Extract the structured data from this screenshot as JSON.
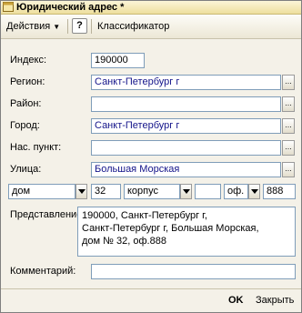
{
  "window": {
    "title": "Юридический адрес *"
  },
  "toolbar": {
    "actions_label": "Действия",
    "help_label": "?",
    "classifier_label": "Классификатор"
  },
  "form": {
    "index_label": "Индекс:",
    "index_value": "190000",
    "region_label": "Регион:",
    "region_value": "Санкт-Петербург г",
    "district_label": "Район:",
    "district_value": "",
    "city_label": "Город:",
    "city_value": "Санкт-Петербург г",
    "settlement_label": "Нас. пункт:",
    "settlement_value": "",
    "street_label": "Улица:",
    "street_value": "Большая Морская",
    "house_type": "дом",
    "house_number": "32",
    "building_type": "корпус",
    "building_number": "",
    "office_type": "оф.",
    "office_number": "888",
    "presentation_label": "Представление:",
    "presentation_lines": [
      "190000, Санкт-Петербург г,",
      "Санкт-Петербург г, Большая Морская,",
      "дом № 32, оф.888"
    ],
    "comment_label": "Комментарий:",
    "comment_value": ""
  },
  "footer": {
    "ok_label": "OK",
    "close_label": "Закрыть"
  },
  "icons": {
    "app": "app-window-icon",
    "dropdown": "chevron-down-icon",
    "pick": "ellipsis-icon"
  }
}
